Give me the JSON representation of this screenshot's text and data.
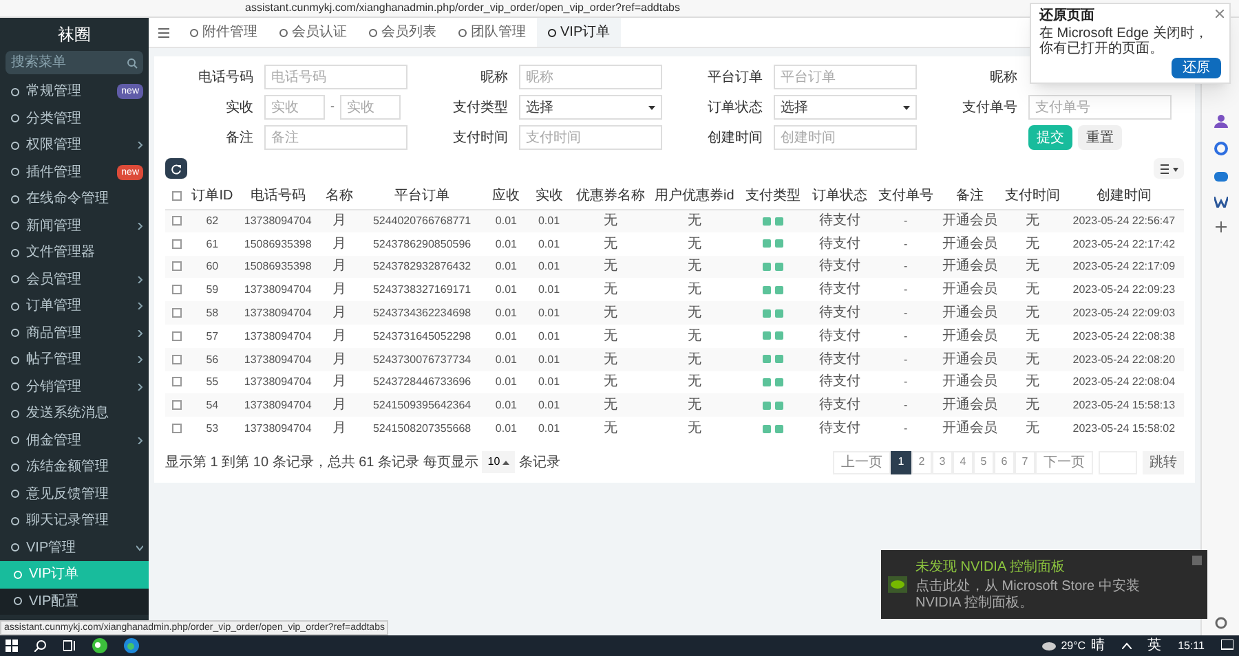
{
  "browser": {
    "url": "assistant.cunmykj.com/xianghanadmin.php/order_vip_order/open_vip_order?ref=addtabs"
  },
  "sidebar": {
    "title": "袜圈",
    "search_placeholder": "搜索菜单",
    "items": [
      {
        "label": "常规管理",
        "kind": "link",
        "selected": false,
        "badge": "new",
        "color": "#605ca8"
      },
      {
        "label": "分类管理",
        "kind": "link",
        "selected": false
      },
      {
        "label": "权限管理",
        "kind": "group",
        "selected": false,
        "expanded": false
      },
      {
        "label": "插件管理",
        "kind": "link",
        "selected": false,
        "badge": "new",
        "color": "#dd4b39"
      },
      {
        "label": "在线命令管理",
        "kind": "link",
        "selected": false
      },
      {
        "label": "新闻管理",
        "kind": "group",
        "selected": false,
        "expanded": false
      },
      {
        "label": "文件管理器",
        "kind": "link",
        "selected": false
      },
      {
        "label": "会员管理",
        "kind": "group",
        "selected": false,
        "expanded": false
      },
      {
        "label": "订单管理",
        "kind": "group",
        "selected": false,
        "expanded": false
      },
      {
        "label": "商品管理",
        "kind": "group",
        "selected": false,
        "expanded": false
      },
      {
        "label": "帖子管理",
        "kind": "group",
        "selected": false,
        "expanded": false
      },
      {
        "label": "分销管理",
        "kind": "group",
        "selected": false,
        "expanded": false
      },
      {
        "label": "发送系统消息",
        "kind": "link",
        "selected": false
      },
      {
        "label": "佣金管理",
        "kind": "group",
        "selected": false,
        "expanded": false
      },
      {
        "label": "冻结金额管理",
        "kind": "link",
        "selected": false
      },
      {
        "label": "意见反馈管理",
        "kind": "link",
        "selected": false
      },
      {
        "label": "聊天记录管理",
        "kind": "link",
        "selected": false
      },
      {
        "label": "VIP管理",
        "kind": "group",
        "selected": false,
        "expanded": true,
        "children": [
          {
            "label": "VIP订单",
            "selected": true
          },
          {
            "label": "VIP配置",
            "selected": false
          }
        ]
      }
    ]
  },
  "tabs": [
    {
      "label": "附件管理",
      "selected": false
    },
    {
      "label": "会员认证",
      "selected": false
    },
    {
      "label": "会员列表",
      "selected": false
    },
    {
      "label": "团队管理",
      "selected": false
    },
    {
      "label": "VIP订单",
      "selected": true
    }
  ],
  "filters": [
    [
      {
        "label": "电话号码",
        "kind": "text",
        "placeholder": "电话号码"
      },
      {
        "label": "昵称",
        "kind": "text",
        "placeholder": "昵称"
      },
      {
        "label": "平台订单",
        "kind": "text",
        "placeholder": "平台订单"
      },
      {
        "label": "昵称"
      }
    ],
    [
      {
        "label": "实收",
        "kind": "range",
        "placeholder": "实收",
        "placeholder_to": "实收",
        "separator": "-"
      },
      {
        "label": "支付类型",
        "kind": "select",
        "value": "选择"
      },
      {
        "label": "订单状态",
        "kind": "select",
        "value": "选择"
      },
      {
        "label": "支付单号",
        "kind": "text",
        "placeholder": "支付单号"
      }
    ],
    [
      {
        "label": "备注",
        "kind": "text",
        "placeholder": "备注"
      },
      {
        "label": "支付时间",
        "kind": "text",
        "placeholder": "支付时间"
      },
      {
        "label": "创建时间",
        "kind": "text",
        "placeholder": "创建时间"
      },
      {
        "kind": "buttons",
        "submit": "提交",
        "reset": "重置"
      }
    ]
  ],
  "table": {
    "all_checked": false,
    "columns": [
      {
        "label": "订单ID",
        "kind": "text"
      },
      {
        "label": "电话号码",
        "kind": "text"
      },
      {
        "label": "名称",
        "kind": "text"
      },
      {
        "label": "平台订单",
        "kind": "text"
      },
      {
        "label": "应收",
        "kind": "text"
      },
      {
        "label": "实收",
        "kind": "text"
      },
      {
        "label": "优惠券名称",
        "kind": "text"
      },
      {
        "label": "用户优惠券id",
        "kind": "text"
      },
      {
        "label": "支付类型",
        "kind": "pay_icons"
      },
      {
        "label": "订单状态",
        "kind": "text"
      },
      {
        "label": "支付单号",
        "kind": "text"
      },
      {
        "label": "备注",
        "kind": "text"
      },
      {
        "label": "支付时间",
        "kind": "text"
      },
      {
        "label": "创建时间",
        "kind": "text"
      }
    ],
    "rows": [
      {
        "checked": false,
        "cells": [
          "62",
          "13738094704",
          "月",
          "5244020766768771",
          "0.01",
          "0.01",
          "无",
          "无",
          "",
          "待支付",
          "-",
          "开通会员",
          "无",
          "2023-05-24 22:56:47"
        ]
      },
      {
        "checked": false,
        "cells": [
          "61",
          "15086935398",
          "月",
          "5243786290850596",
          "0.01",
          "0.01",
          "无",
          "无",
          "",
          "待支付",
          "-",
          "开通会员",
          "无",
          "2023-05-24 22:17:42"
        ]
      },
      {
        "checked": false,
        "cells": [
          "60",
          "15086935398",
          "月",
          "5243782932876432",
          "0.01",
          "0.01",
          "无",
          "无",
          "",
          "待支付",
          "-",
          "开通会员",
          "无",
          "2023-05-24 22:17:09"
        ]
      },
      {
        "checked": false,
        "cells": [
          "59",
          "13738094704",
          "月",
          "5243738327169171",
          "0.01",
          "0.01",
          "无",
          "无",
          "",
          "待支付",
          "-",
          "开通会员",
          "无",
          "2023-05-24 22:09:23"
        ]
      },
      {
        "checked": false,
        "cells": [
          "58",
          "13738094704",
          "月",
          "5243734362234698",
          "0.01",
          "0.01",
          "无",
          "无",
          "",
          "待支付",
          "-",
          "开通会员",
          "无",
          "2023-05-24 22:09:03"
        ]
      },
      {
        "checked": false,
        "cells": [
          "57",
          "13738094704",
          "月",
          "5243731645052298",
          "0.01",
          "0.01",
          "无",
          "无",
          "",
          "待支付",
          "-",
          "开通会员",
          "无",
          "2023-05-24 22:08:38"
        ]
      },
      {
        "checked": false,
        "cells": [
          "56",
          "13738094704",
          "月",
          "5243730076737734",
          "0.01",
          "0.01",
          "无",
          "无",
          "",
          "待支付",
          "-",
          "开通会员",
          "无",
          "2023-05-24 22:08:20"
        ]
      },
      {
        "checked": false,
        "cells": [
          "55",
          "13738094704",
          "月",
          "5243728446733696",
          "0.01",
          "0.01",
          "无",
          "无",
          "",
          "待支付",
          "-",
          "开通会员",
          "无",
          "2023-05-24 22:08:04"
        ]
      },
      {
        "checked": false,
        "cells": [
          "54",
          "13738094704",
          "月",
          "5241509395642364",
          "0.01",
          "0.01",
          "无",
          "无",
          "",
          "待支付",
          "-",
          "开通会员",
          "无",
          "2023-05-24 15:58:13"
        ]
      },
      {
        "checked": false,
        "cells": [
          "53",
          "13738094704",
          "月",
          "5241508207355668",
          "0.01",
          "0.01",
          "无",
          "无",
          "",
          "待支付",
          "-",
          "开通会员",
          "无",
          "2023-05-24 15:58:02"
        ]
      }
    ]
  },
  "pagination": {
    "info": "显示第 1 到第 10 条记录，总共 61 条记录 每页显示",
    "page_size": "10",
    "info_after": "条记录",
    "prev": "上一页",
    "pages": [
      {
        "label": "1",
        "selected": true
      },
      {
        "label": "2",
        "selected": false
      },
      {
        "label": "3",
        "selected": false
      },
      {
        "label": "4",
        "selected": false
      },
      {
        "label": "5",
        "selected": false
      },
      {
        "label": "6",
        "selected": false
      },
      {
        "label": "7",
        "selected": false
      }
    ],
    "next": "下一页",
    "jump": "跳转"
  },
  "restore_popup": {
    "title": "还原页面",
    "message": "在 Microsoft Edge 关闭时，你有已打开的页面。",
    "button": "还原"
  },
  "toast": {
    "title": "未发现 NVIDIA 控制面板",
    "message": "点击此处，从 Microsoft Store 中安装 NVIDIA 控制面板。"
  },
  "status_url": "assistant.cunmykj.com/xianghanadmin.php/order_vip_order/open_vip_order?ref=addtabs",
  "taskbar": {
    "weather": "29°C",
    "weather_text": "晴",
    "input_method": "英",
    "time": "15:11"
  }
}
